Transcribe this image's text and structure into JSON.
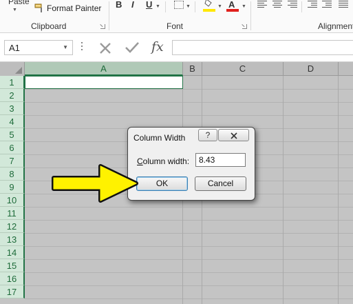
{
  "ribbon": {
    "paste_label": "Paste",
    "format_painter_label": "Format Painter",
    "clipboard_group": "Clipboard",
    "font_group": "Font",
    "alignment_group": "Alignment",
    "bold_label": "B",
    "italic_label": "I",
    "underline_label": "U",
    "font_color_letter": "A",
    "highlight_color": "#ffe800",
    "font_color": "#e0201c"
  },
  "formula_bar": {
    "name_box_value": "A1",
    "fx_label": "fx",
    "cancel_icon": "close-icon",
    "enter_icon": "check-icon",
    "formula_value": ""
  },
  "grid": {
    "columns": [
      "A",
      "B",
      "C",
      "D"
    ],
    "rows": [
      "1",
      "2",
      "3",
      "4",
      "5",
      "6",
      "7",
      "8",
      "9",
      "10",
      "11",
      "12",
      "13",
      "14",
      "15",
      "16",
      "17"
    ],
    "selected_column": "A",
    "selected_cell": "A1"
  },
  "dialog": {
    "title": "Column Width",
    "help_label": "?",
    "close_label": "X",
    "label_underlined": "C",
    "label_rest": "olumn width:",
    "width_value": "8.43",
    "ok_label": "OK",
    "cancel_label": "Cancel"
  },
  "annotation": {
    "arrow_color": "#fff200",
    "arrow_outline": "#111111",
    "points_to": "ok-button"
  }
}
